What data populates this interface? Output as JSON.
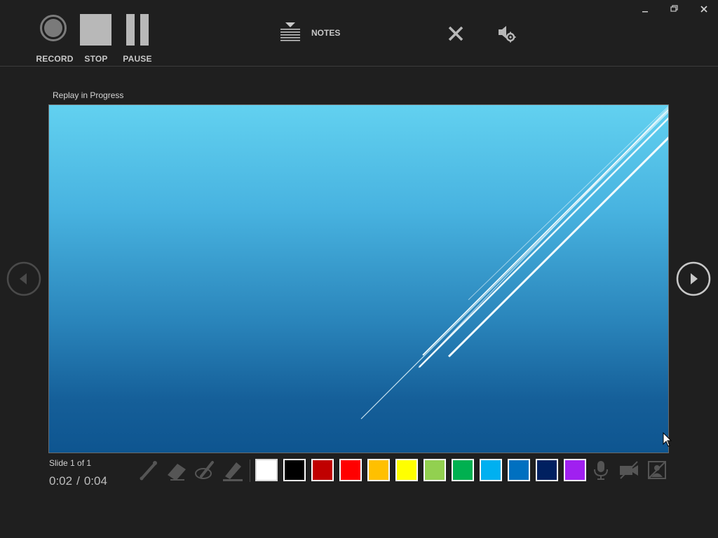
{
  "toolbar": {
    "record_label": "RECORD",
    "stop_label": "STOP",
    "pause_label": "PAUSE",
    "notes_label": "NOTES",
    "close_icon": "close-x-icon",
    "audio_icon": "speaker-settings-icon"
  },
  "window_controls": [
    "minimize-icon",
    "restore-icon",
    "close-icon"
  ],
  "main": {
    "replay_status": "Replay in Progress",
    "slide_count": "Slide 1 of 1",
    "time_current": "0:02",
    "time_separator": "/",
    "time_total": "0:04",
    "prev_icon": "chevron-left-circle-icon",
    "next_icon": "chevron-right-circle-icon"
  },
  "pen_tools": [
    "laser-pointer-icon",
    "eraser-icon",
    "pen-icon",
    "highlighter-icon"
  ],
  "ink_colors": [
    "#ffffff",
    "#000000",
    "#c00000",
    "#ff0000",
    "#ffc000",
    "#ffff00",
    "#92d050",
    "#00b050",
    "#00b0f0",
    "#0070c0",
    "#002060",
    "#a020f0"
  ],
  "media_controls": [
    "microphone-icon",
    "camera-off-icon",
    "camera-preview-off-icon"
  ]
}
